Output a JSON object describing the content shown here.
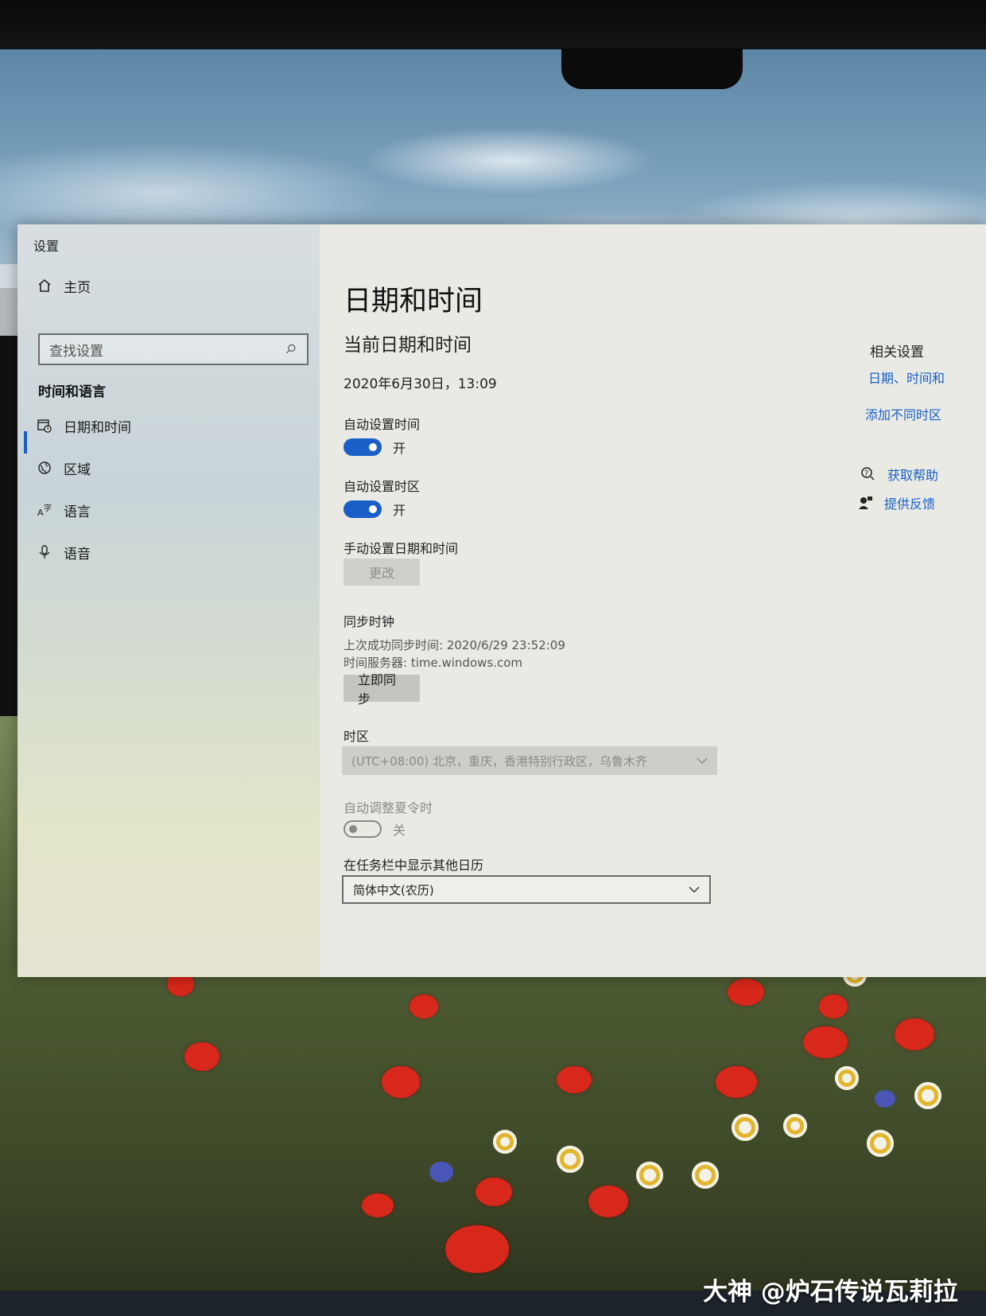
{
  "window": {
    "title": "设置"
  },
  "sidebar": {
    "home": "主页",
    "search_placeholder": "查找设置",
    "section": "时间和语言",
    "items": [
      {
        "label": "日期和时间",
        "icon": "calendar-clock-icon",
        "active": true
      },
      {
        "label": "区域",
        "icon": "globe-icon",
        "active": false
      },
      {
        "label": "语言",
        "icon": "language-icon",
        "active": false
      },
      {
        "label": "语音",
        "icon": "microphone-icon",
        "active": false
      }
    ]
  },
  "main": {
    "title": "日期和时间",
    "current_heading": "当前日期和时间",
    "current_value": "2020年6月30日，13:09",
    "auto_time": {
      "label": "自动设置时间",
      "state": "开",
      "on": true
    },
    "auto_timezone": {
      "label": "自动设置时区",
      "state": "开",
      "on": true
    },
    "manual": {
      "label": "手动设置日期和时间",
      "button": "更改"
    },
    "sync": {
      "heading": "同步时钟",
      "last_sync": "上次成功同步时间: 2020/6/29 23:52:09",
      "server": "时间服务器: time.windows.com",
      "button": "立即同步"
    },
    "timezone": {
      "label": "时区",
      "value": "(UTC+08:00) 北京，重庆，香港特别行政区，乌鲁木齐"
    },
    "dst": {
      "label": "自动调整夏令时",
      "state": "关",
      "on": false
    },
    "calendar": {
      "label": "在任务栏中显示其他日历",
      "value": "简体中文(农历)"
    }
  },
  "related": {
    "heading": "相关设置",
    "links": [
      "日期、时间和",
      "添加不同时区"
    ],
    "help": "获取帮助",
    "feedback": "提供反馈"
  },
  "watermark": "大神 @炉石传说瓦莉拉",
  "colors": {
    "accent": "#1a5fc7",
    "window_bg": "#e9eae4"
  }
}
